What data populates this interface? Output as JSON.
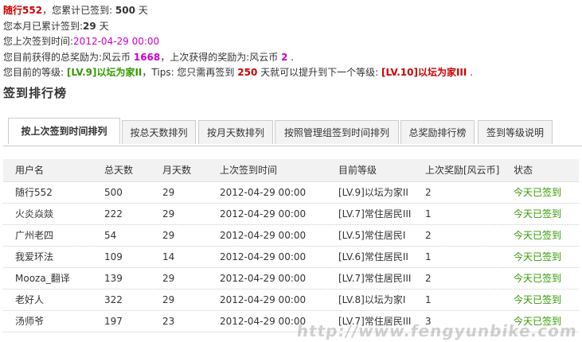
{
  "info": {
    "username": "随行552",
    "total_signin_text": "，您累计已签到: ",
    "total_days": "500",
    "day_unit": " 天",
    "month_text": "您本月已累计签到:",
    "month_days": "29",
    "last_time_label": "您上次签到时间:",
    "last_time": "2012-04-29 00:00",
    "reward_prefix": "您目前获得的总奖励为:风云币 ",
    "total_reward": "1668",
    "last_reward_text": "，上次获得的奖励为:风云币 ",
    "last_reward": "2",
    "period": " .",
    "level_prefix": "您目前的等级: ",
    "current_level": "[LV.9]以坛为家II",
    "tips_text": "，Tips: 您只需再签到 ",
    "days_needed": "250",
    "upgrade_text": " 天就可以提升到下一个等级: ",
    "next_level": "[LV.10]以坛为家III"
  },
  "section_title": "签到排行榜",
  "tabs": [
    "按上次签到时间排列",
    "按总天数排列",
    "按月天数排列",
    "按照管理组签到时间排列",
    "总奖励排行榜",
    "签到等级说明"
  ],
  "table": {
    "headers": [
      "用户名",
      "总天数",
      "月天数",
      "上次签到时间",
      "目前等级",
      "上次奖励[风云币]",
      "状态"
    ],
    "rows": [
      [
        "随行552",
        "500",
        "29",
        "2012-04-29 00:00",
        "[LV.9]以坛为家II",
        "2",
        "今天已签到"
      ],
      [
        "火炎焱燚",
        "222",
        "29",
        "2012-04-29 00:00",
        "[LV.7]常住居民III",
        "1",
        "今天已签到"
      ],
      [
        "广州老四",
        "54",
        "29",
        "2012-04-29 00:00",
        "[LV.5]常住居民I",
        "2",
        "今天已签到"
      ],
      [
        "我爱环法",
        "109",
        "14",
        "2012-04-29 00:00",
        "[LV.6]常住居民II",
        "1",
        "今天已签到"
      ],
      [
        "Mooza_翻译",
        "139",
        "29",
        "2012-04-29 00:00",
        "[LV.7]常住居民III",
        "2",
        "今天已签到"
      ],
      [
        "老好人",
        "322",
        "29",
        "2012-04-29 00:00",
        "[LV.8]以坛为家I",
        "1",
        "今天已签到"
      ],
      [
        "汤师爷",
        "197",
        "23",
        "2012-04-29 00:00",
        "[LV.7]常住居民III",
        "3",
        "今天已签到"
      ]
    ]
  },
  "watermark": "http://www.fengyunbike.com",
  "colors": {
    "accent_red": "#cc0000",
    "magenta": "#cc00cc",
    "status_green": "#339900"
  }
}
